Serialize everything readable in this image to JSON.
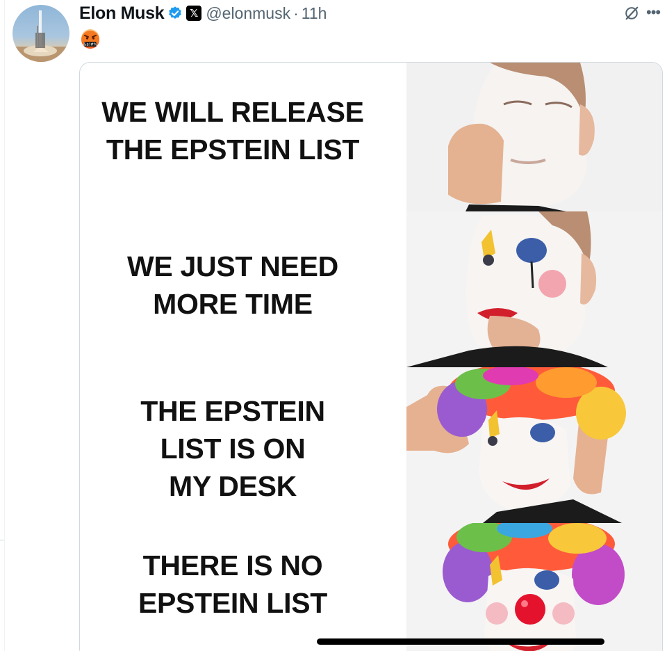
{
  "tweet": {
    "author_name": "Elon Musk",
    "handle": "@elonmusk",
    "separator": "·",
    "time": "11h",
    "affiliate_badge": "𝕏",
    "emoji": "face-with-symbols-on-mouth",
    "icons": [
      "avatar-rocket",
      "verified-badge-icon",
      "x-affiliate-icon",
      "grok-icon",
      "more-icon"
    ]
  },
  "meme": {
    "panels": [
      {
        "caption": "WE WILL RELEASE\nTHE EPSTEIN LIST",
        "stage": "white-face-paint"
      },
      {
        "caption": "WE JUST NEED\nMORE TIME",
        "stage": "clown-makeup"
      },
      {
        "caption": "THE EPSTEIN\nLIST IS ON\nMY DESK",
        "stage": "clown-wig"
      },
      {
        "caption": "THERE IS NO\nEPSTEIN LIST",
        "stage": "full-clown-nose"
      }
    ]
  },
  "colors": {
    "text": "#0f1419",
    "secondary": "#536471",
    "verified_blue": "#1d9bf0",
    "border": "#cfd9de"
  }
}
